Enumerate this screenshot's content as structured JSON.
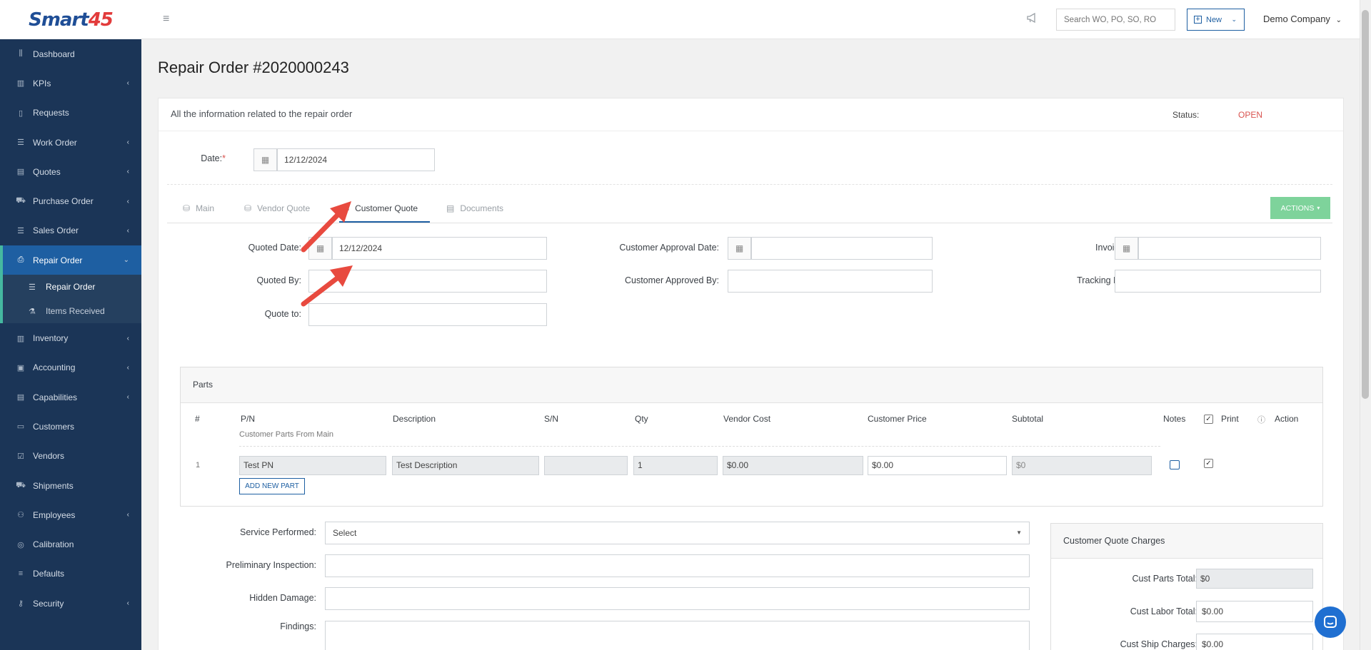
{
  "brand": {
    "name_part1": "Smart",
    "name_part2": "45"
  },
  "sidebar": {
    "items": [
      {
        "label": "Dashboard",
        "icon": "chart-icon",
        "chevron": false
      },
      {
        "label": "KPIs",
        "icon": "bar-chart-icon",
        "chevron": true
      },
      {
        "label": "Requests",
        "icon": "file-icon",
        "chevron": false
      },
      {
        "label": "Work Order",
        "icon": "list-icon",
        "chevron": true
      },
      {
        "label": "Quotes",
        "icon": "document-icon",
        "chevron": true
      },
      {
        "label": "Purchase Order",
        "icon": "cart-icon",
        "chevron": true
      },
      {
        "label": "Sales Order",
        "icon": "list-icon",
        "chevron": true
      },
      {
        "label": "Repair Order",
        "icon": "printer-icon",
        "chevron": true,
        "active": true
      },
      {
        "label": "Inventory",
        "icon": "bar-chart-icon",
        "chevron": true
      },
      {
        "label": "Accounting",
        "icon": "calculator-icon",
        "chevron": true
      },
      {
        "label": "Capabilities",
        "icon": "document-icon",
        "chevron": true
      },
      {
        "label": "Customers",
        "icon": "briefcase-icon",
        "chevron": false
      },
      {
        "label": "Vendors",
        "icon": "check-square-icon",
        "chevron": false
      },
      {
        "label": "Shipments",
        "icon": "truck-icon",
        "chevron": false
      },
      {
        "label": "Employees",
        "icon": "users-icon",
        "chevron": true
      },
      {
        "label": "Calibration",
        "icon": "target-icon",
        "chevron": false
      },
      {
        "label": "Defaults",
        "icon": "menu-icon",
        "chevron": false
      },
      {
        "label": "Security",
        "icon": "key-icon",
        "chevron": true
      }
    ],
    "sub_items": [
      {
        "label": "Repair Order",
        "icon": "list-icon"
      },
      {
        "label": "Items Received",
        "icon": "flask-icon"
      }
    ]
  },
  "topbar": {
    "search_placeholder": "Search WO, PO, SO, RO",
    "new_label": "New",
    "company": "Demo Company"
  },
  "page": {
    "title": "Repair Order #2020000243",
    "subtitle": "All the information related to the repair order",
    "status_label": "Status:",
    "status_value": "OPEN",
    "date_label": "Date:",
    "date_required": "*",
    "date_value": "12/12/2024"
  },
  "tabs": [
    {
      "label": "Main",
      "active": false
    },
    {
      "label": "Vendor Quote",
      "active": false
    },
    {
      "label": "Customer Quote",
      "active": true
    },
    {
      "label": "Documents",
      "active": false
    }
  ],
  "actions_label": "ACTIONS",
  "quote": {
    "quoted_date_label": "Quoted Date:",
    "quoted_date_value": "12/12/2024",
    "quoted_by_label": "Quoted By:",
    "quoted_by_value": "",
    "quote_to_label": "Quote to:",
    "quote_to_value": "",
    "cust_approval_date_label": "Customer Approval Date:",
    "cust_approval_date_value": "",
    "cust_approved_by_label": "Customer Approved By:",
    "cust_approved_by_value": "",
    "invoice_date_label": "Invoice Date:",
    "invoice_date_value": "",
    "tracking_label": "Tracking Number:",
    "tracking_value": ""
  },
  "parts": {
    "title": "Parts",
    "columns": [
      "#",
      "P/N",
      "Description",
      "S/N",
      "Qty",
      "Vendor Cost",
      "Customer Price",
      "Subtotal",
      "Notes",
      "Print",
      "Action"
    ],
    "note": "Customer Parts From Main",
    "rows": [
      {
        "num": "1",
        "pn": "Test PN",
        "description": "Test Description",
        "sn": "",
        "qty": "1",
        "vendor_cost": "$0.00",
        "customer_price": "$0.00",
        "subtotal": "$0"
      }
    ],
    "add_label": "ADD NEW PART"
  },
  "details": {
    "service_label": "Service Performed:",
    "service_value": "Select",
    "prelim_label": "Preliminary Inspection:",
    "hidden_label": "Hidden Damage:",
    "findings_label": "Findings:"
  },
  "charges": {
    "title": "Customer Quote Charges",
    "parts_total_label": "Cust Parts Total:",
    "parts_total_value": "$0",
    "labor_total_label": "Cust Labor Total:",
    "labor_total_value": "$0.00",
    "ship_label": "Cust Ship Charges:",
    "ship_value": "$0.00"
  }
}
